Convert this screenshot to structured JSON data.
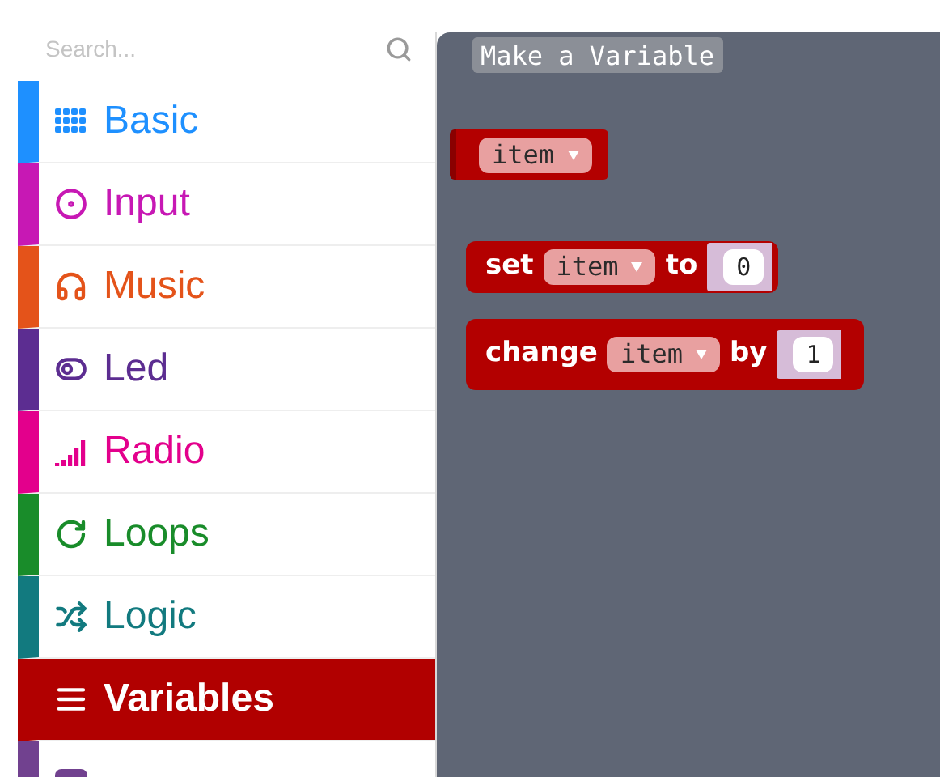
{
  "sidebar": {
    "search": {
      "placeholder": "Search..."
    },
    "categories": [
      {
        "label": "Basic",
        "color": "#1e90ff",
        "selected": false
      },
      {
        "label": "Input",
        "color": "#c718b4",
        "selected": false
      },
      {
        "label": "Music",
        "color": "#e4531a",
        "selected": false
      },
      {
        "label": "Led",
        "color": "#5c2d91",
        "selected": false
      },
      {
        "label": "Radio",
        "color": "#e3008c",
        "selected": false
      },
      {
        "label": "Loops",
        "color": "#198c2a",
        "selected": false
      },
      {
        "label": "Logic",
        "color": "#127a7f",
        "selected": false
      },
      {
        "label": "Variables",
        "color": "#b10000",
        "selected": true
      },
      {
        "color": "#71418f",
        "selected": false
      }
    ]
  },
  "workspace": {
    "button": "Make a Variable",
    "blocks": [
      {
        "kind": "reporter",
        "parts": [
          {
            "kind": "dropdown",
            "text": "item"
          }
        ]
      },
      {
        "kind": "statement",
        "parts": [
          {
            "kind": "label",
            "text": "set"
          },
          {
            "kind": "dropdown",
            "text": "item"
          },
          {
            "kind": "label",
            "text": "to"
          },
          {
            "kind": "number",
            "text": "0"
          }
        ]
      },
      {
        "kind": "statement",
        "parts": [
          {
            "kind": "label",
            "text": "change"
          },
          {
            "kind": "dropdown",
            "text": "item"
          },
          {
            "kind": "label",
            "text": "by"
          },
          {
            "kind": "number",
            "text": "1"
          }
        ]
      }
    ]
  }
}
